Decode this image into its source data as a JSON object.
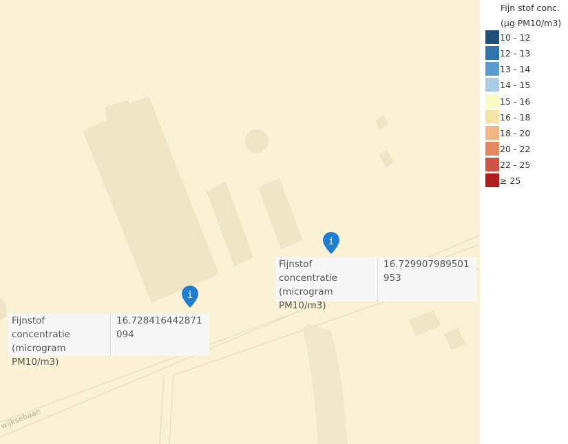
{
  "map": {
    "road_label": "wijksebaan",
    "markers": [
      {
        "icon": "info-icon",
        "color": "#1f7ecf",
        "popup": {
          "key": "Fijnstof concentratie (microgram PM10/m3)",
          "value": "16.729907989501953"
        }
      },
      {
        "icon": "info-icon",
        "color": "#1f7ecf",
        "popup": {
          "key": "Fijnstof concentratie (microgram PM10/m3)",
          "value": "16.728416442871094"
        }
      }
    ]
  },
  "legend": {
    "title_line1": "Fijn stof conc.",
    "title_line2": "(µg PM10/m3)",
    "items": [
      {
        "label": "10 - 12",
        "color": "#1f4e79"
      },
      {
        "label": "12 - 13",
        "color": "#2e75b0"
      },
      {
        "label": "13 - 14",
        "color": "#5b9bd0"
      },
      {
        "label": "14 - 15",
        "color": "#a9cbe6"
      },
      {
        "label": "15 - 16",
        "color": "#fdfbc4"
      },
      {
        "label": "16 - 18",
        "color": "#f7e4a9"
      },
      {
        "label": "18 - 20",
        "color": "#efb784"
      },
      {
        "label": "20 - 22",
        "color": "#e5885f"
      },
      {
        "label": "22 - 25",
        "color": "#cd5545"
      },
      {
        "label": "≥ 25",
        "color": "#b01c1c"
      }
    ]
  }
}
